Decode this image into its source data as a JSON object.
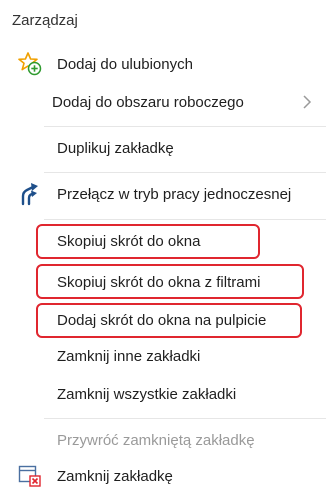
{
  "menu": {
    "header": "Zarządzaj",
    "items": [
      {
        "label": "Dodaj do ulubionych",
        "icon": "star-plus-icon",
        "enabled": true
      },
      {
        "label": "Dodaj do obszaru roboczego",
        "icon": null,
        "submenu": true,
        "enabled": true
      },
      {
        "label": "Duplikuj zakładkę",
        "icon": null,
        "enabled": true
      },
      {
        "label": "Przełącz w tryb pracy jednoczesnej",
        "icon": "split-arrows-icon",
        "enabled": true
      },
      {
        "label": "Skopiuj skrót do okna",
        "icon": null,
        "enabled": true,
        "highlighted": true
      },
      {
        "label": "Skopiuj skrót do okna z filtrami",
        "icon": null,
        "enabled": true,
        "highlighted": true
      },
      {
        "label": "Dodaj skrót do okna na pulpicie",
        "icon": null,
        "enabled": true,
        "highlighted": true
      },
      {
        "label": "Zamknij inne zakładki",
        "icon": null,
        "enabled": true
      },
      {
        "label": "Zamknij wszystkie zakładki",
        "icon": null,
        "enabled": true
      },
      {
        "label": "Przywróć zamkniętą zakładkę",
        "icon": null,
        "enabled": false
      },
      {
        "label": "Zamknij zakładkę",
        "icon": "close-tab-icon",
        "enabled": true
      }
    ]
  },
  "colors": {
    "highlight": "#e0262f",
    "star": "#f0a000",
    "plus": "#2e9a2e",
    "arrow": "#1e4f8a",
    "close": "#e0262f"
  }
}
